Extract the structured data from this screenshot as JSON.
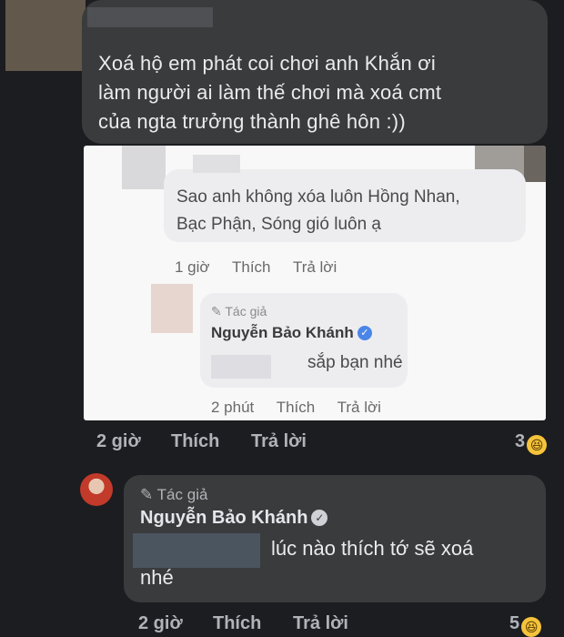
{
  "top_comment": {
    "text_lines": [
      "Xoá hộ em phát coi chơi anh Khắn ơi",
      "làm người ai làm thế chơi mà xoá cmt",
      "của ngta trưởng thành ghê hôn :))"
    ],
    "time": "2 giờ",
    "like_label": "Thích",
    "reply_label": "Trả lời",
    "reaction_count": "3",
    "reaction_icon": "laugh-emoji"
  },
  "screenshot_card": {
    "comment_lines": [
      "Sao anh không xóa luôn Hồng Nhan,",
      "Bạc Phận, Sóng gió luôn ạ"
    ],
    "time": "1 giờ",
    "like_label": "Thích",
    "reply_label": "Trả lời",
    "reply": {
      "author_label": "Tác giả",
      "name": "Nguyễn Bảo Khánh",
      "text": "sắp bạn nhé",
      "time": "2 phút",
      "like_label": "Thích",
      "reply_label": "Trả lời"
    }
  },
  "author_reply": {
    "author_label": "Tác giả",
    "name": "Nguyễn Bảo Khánh",
    "text_line1": "lúc nào thích tớ sẽ xoá",
    "text_line2": "nhé",
    "time": "2 giờ",
    "like_label": "Thích",
    "reply_label": "Trả lời",
    "reaction_count": "5",
    "reaction_icon": "laugh-emoji"
  },
  "colors": {
    "background": "#1c1d20",
    "bubble": "#3a3b3c",
    "verified": "#4a86e8",
    "reaction": "#f5c33b"
  }
}
